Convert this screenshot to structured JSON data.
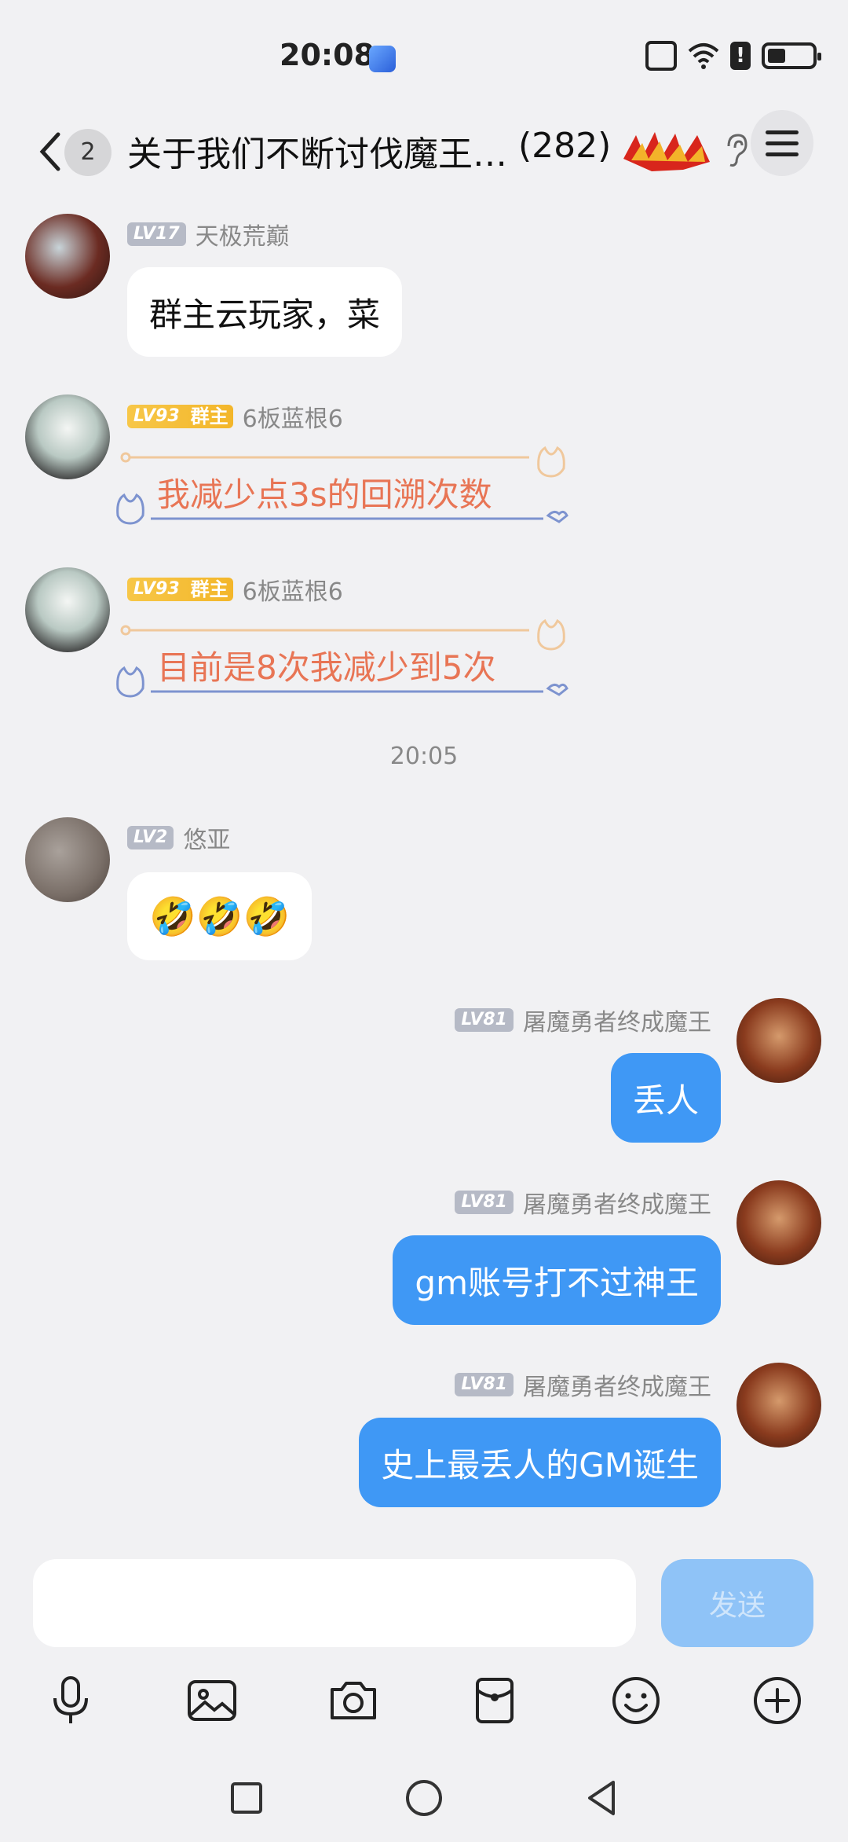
{
  "status_bar": {
    "time": "20:08"
  },
  "header": {
    "unread_count": "2",
    "title": "关于我们不断讨伐魔王…",
    "member_count": "(282)"
  },
  "messages": [
    {
      "level": "LV17",
      "name": "天极荒巅",
      "text": "群主云玩家，菜"
    },
    {
      "level": "LV93",
      "role": "群主",
      "name": "6板蓝根6",
      "text": "我减少点3s的回溯次数"
    },
    {
      "level": "LV93",
      "role": "群主",
      "name": "6板蓝根6",
      "text": "目前是8次我减少到5次"
    },
    {
      "level": "LV2",
      "name": "悠亚",
      "text": "🤣🤣🤣"
    },
    {
      "level": "LV81",
      "name": "屠魔勇者终成魔王",
      "text": "丢人"
    },
    {
      "level": "LV81",
      "name": "屠魔勇者终成魔王",
      "text": "gm账号打不过神王"
    },
    {
      "level": "LV81",
      "name": "屠魔勇者终成魔王",
      "text": "史上最丢人的GM诞生"
    }
  ],
  "timestamp": "20:05",
  "composer": {
    "placeholder": "",
    "send_label": "发送"
  },
  "colors": {
    "accent": "#3f98f5",
    "background": "#f1f1f3",
    "owner_badge": "#f5b52d",
    "deco_text": "#e87555"
  }
}
